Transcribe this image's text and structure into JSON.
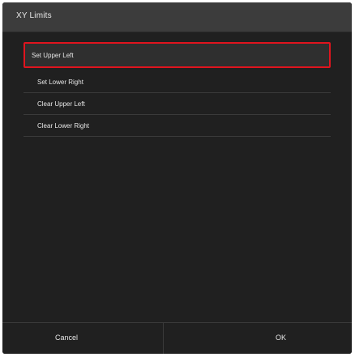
{
  "dialog": {
    "title": "XY Limits",
    "menu_items": [
      {
        "label": "Set Upper Left",
        "selected": true
      },
      {
        "label": "Set Lower Right",
        "selected": false
      },
      {
        "label": "Clear Upper Left",
        "selected": false
      },
      {
        "label": "Clear Lower Right",
        "selected": false
      }
    ],
    "cancel_label": "Cancel",
    "ok_label": "OK"
  },
  "colors": {
    "background": "#202020",
    "titlebar": "#3c3c3c",
    "selection_border": "#e0141e",
    "text": "#e6e6e6"
  }
}
